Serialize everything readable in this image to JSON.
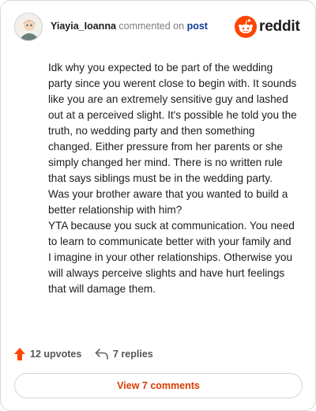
{
  "header": {
    "username": "Yiayia_Ioanna",
    "action_text": " commented on ",
    "post_link": "post",
    "brand_word": "reddit"
  },
  "comment": {
    "paragraphs": [
      "Idk why you expected to be part of the wedding party since you werent close to begin with. It sounds like you are an extremely sensitive guy and lashed out at a perceived slight. It's possible he told you the truth, no wedding party and then something changed. Either pressure from her parents or she simply changed her mind. There is no written rule that says siblings must be in the wedding party.",
      "Was your brother aware that you wanted to build a better relationship with him?",
      "YTA because you suck at communication. You need to learn to communicate better with your family and I imagine in your other relationships. Otherwise you will always perceive slights and have hurt feelings that will damage them."
    ]
  },
  "actions": {
    "upvotes_label": "12 upvotes",
    "replies_label": "7 replies"
  },
  "view_button": {
    "label": "View 7 comments"
  },
  "colors": {
    "accent": "#ff4500",
    "link": "#0b3d91",
    "button_text": "#d93a00"
  },
  "icons": {
    "upvote": "upvote-arrow-icon",
    "reply": "reply-arrow-icon",
    "brand": "reddit-snoo-icon"
  }
}
